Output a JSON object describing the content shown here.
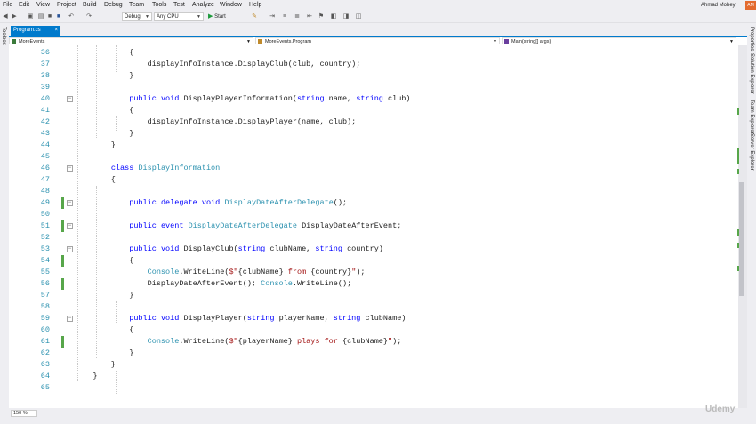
{
  "menu": [
    "File",
    "Edit",
    "View",
    "Project",
    "Build",
    "Debug",
    "Team",
    "Tools",
    "Test",
    "Analyze",
    "Window",
    "Help"
  ],
  "user": {
    "name": "Ahmad Mohey",
    "initials": "AM"
  },
  "toolbar": {
    "configuration": "Debug",
    "platform": "Any CPU",
    "start_label": "Start"
  },
  "toolbox_label": "Toolbox",
  "tab": {
    "label": "Program.cs",
    "close": "×"
  },
  "navigation": {
    "project": "MoreEvents",
    "type": "MoreEvents.Program",
    "member": "Main(string[] args)"
  },
  "side_tabs": [
    "Properties",
    "Solution Explorer",
    "Team Explorer",
    "Server Explorer"
  ],
  "zoom": "150 %",
  "watermark": "Udemy",
  "code": {
    "line_numbers": [
      "36",
      "37",
      "38",
      "39",
      "40",
      "41",
      "42",
      "43",
      "44",
      "45",
      "46",
      "47",
      "48",
      "49",
      "50",
      "51",
      "52",
      "53",
      "54",
      "55",
      "56",
      "57",
      "58",
      "59",
      "60",
      "61",
      "62",
      "63",
      "64",
      "65"
    ],
    "lines": [
      [
        {
          "t": "            {"
        }
      ],
      [
        {
          "t": "                displayInfoInstance.DisplayClub(club, country);"
        }
      ],
      [
        {
          "t": "            }"
        }
      ],
      [
        {
          "t": ""
        }
      ],
      [
        {
          "t": "            "
        },
        {
          "t": "public",
          "c": "kw"
        },
        {
          "t": " "
        },
        {
          "t": "void",
          "c": "kw"
        },
        {
          "t": " DisplayPlayerInformation("
        },
        {
          "t": "string",
          "c": "kw"
        },
        {
          "t": " name, "
        },
        {
          "t": "string",
          "c": "kw"
        },
        {
          "t": " club)"
        }
      ],
      [
        {
          "t": "            {"
        }
      ],
      [
        {
          "t": "                displayInfoInstance.DisplayPlayer(name, club);"
        }
      ],
      [
        {
          "t": "            }"
        }
      ],
      [
        {
          "t": "        }"
        }
      ],
      [
        {
          "t": ""
        }
      ],
      [
        {
          "t": "        "
        },
        {
          "t": "class",
          "c": "kw"
        },
        {
          "t": " "
        },
        {
          "t": "DisplayInformation",
          "c": "ty"
        }
      ],
      [
        {
          "t": "        {"
        }
      ],
      [
        {
          "t": ""
        }
      ],
      [
        {
          "t": "            "
        },
        {
          "t": "public",
          "c": "kw"
        },
        {
          "t": " "
        },
        {
          "t": "delegate",
          "c": "kw"
        },
        {
          "t": " "
        },
        {
          "t": "void",
          "c": "kw"
        },
        {
          "t": " "
        },
        {
          "t": "DisplayDateAfterDelegate",
          "c": "ty"
        },
        {
          "t": "();"
        }
      ],
      [
        {
          "t": ""
        }
      ],
      [
        {
          "t": "            "
        },
        {
          "t": "public",
          "c": "kw"
        },
        {
          "t": " "
        },
        {
          "t": "event",
          "c": "kw"
        },
        {
          "t": " "
        },
        {
          "t": "DisplayDateAfterDelegate",
          "c": "ty"
        },
        {
          "t": " DisplayDateAfterEvent;"
        }
      ],
      [
        {
          "t": ""
        }
      ],
      [
        {
          "t": "            "
        },
        {
          "t": "public",
          "c": "kw"
        },
        {
          "t": " "
        },
        {
          "t": "void",
          "c": "kw"
        },
        {
          "t": " DisplayClub("
        },
        {
          "t": "string",
          "c": "kw"
        },
        {
          "t": " clubName, "
        },
        {
          "t": "string",
          "c": "kw"
        },
        {
          "t": " country)"
        }
      ],
      [
        {
          "t": "            {"
        }
      ],
      [
        {
          "t": "                "
        },
        {
          "t": "Console",
          "c": "ty"
        },
        {
          "t": ".WriteLine("
        },
        {
          "t": "$\"",
          "c": "st"
        },
        {
          "t": "{clubName}"
        },
        {
          "t": " from ",
          "c": "st"
        },
        {
          "t": "{country}"
        },
        {
          "t": "\"",
          "c": "st"
        },
        {
          "t": ");"
        }
      ],
      [
        {
          "t": "                DisplayDateAfterEvent(); "
        },
        {
          "t": "Console",
          "c": "ty"
        },
        {
          "t": ".WriteLine();"
        }
      ],
      [
        {
          "t": "            }"
        }
      ],
      [
        {
          "t": ""
        }
      ],
      [
        {
          "t": "            "
        },
        {
          "t": "public",
          "c": "kw"
        },
        {
          "t": " "
        },
        {
          "t": "void",
          "c": "kw"
        },
        {
          "t": " DisplayPlayer("
        },
        {
          "t": "string",
          "c": "kw"
        },
        {
          "t": " playerName, "
        },
        {
          "t": "string",
          "c": "kw"
        },
        {
          "t": " clubName)"
        }
      ],
      [
        {
          "t": "            {"
        }
      ],
      [
        {
          "t": "                "
        },
        {
          "t": "Console",
          "c": "ty"
        },
        {
          "t": ".WriteLine("
        },
        {
          "t": "$\"",
          "c": "st"
        },
        {
          "t": "{playerName}"
        },
        {
          "t": " plays for ",
          "c": "st"
        },
        {
          "t": "{clubName}"
        },
        {
          "t": "\"",
          "c": "st"
        },
        {
          "t": ");"
        }
      ],
      [
        {
          "t": "            }"
        }
      ],
      [
        {
          "t": "        }"
        }
      ],
      [
        {
          "t": "    }"
        }
      ],
      [
        {
          "t": ""
        }
      ]
    ],
    "changed_line_numbers": [
      "49",
      "51",
      "54",
      "56",
      "61"
    ],
    "folded_line_numbers": [
      "40",
      "46",
      "49",
      "51",
      "53",
      "59"
    ]
  },
  "colors": {
    "accent": "#007acc",
    "keyword": "#0000ff",
    "type": "#2b91af",
    "string": "#a31515",
    "change": "#57a64a"
  }
}
